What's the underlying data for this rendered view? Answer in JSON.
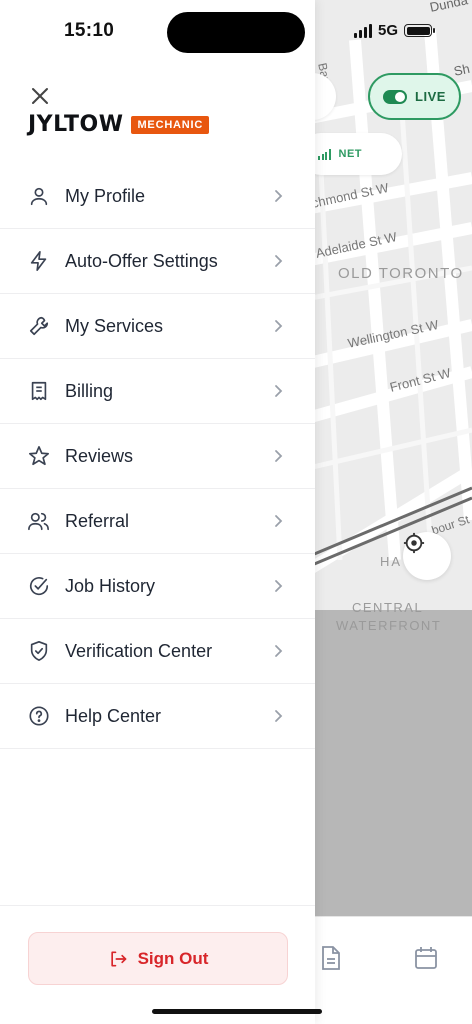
{
  "status_bar": {
    "time": "15:10",
    "network": "5G"
  },
  "brand": {
    "name": "JYLTOW",
    "badge": "MECHANIC",
    "badge_color": "#e8570f"
  },
  "menu": {
    "items": [
      {
        "label": "My Profile",
        "icon": "user-icon"
      },
      {
        "label": "Auto-Offer Settings",
        "icon": "lightning-icon"
      },
      {
        "label": "My Services",
        "icon": "wrench-icon"
      },
      {
        "label": "Billing",
        "icon": "receipt-icon"
      },
      {
        "label": "Reviews",
        "icon": "star-icon"
      },
      {
        "label": "Referral",
        "icon": "users-icon"
      },
      {
        "label": "Job History",
        "icon": "check-circle-icon"
      },
      {
        "label": "Verification Center",
        "icon": "shield-check-icon"
      },
      {
        "label": "Help Center",
        "icon": "help-circle-icon"
      }
    ]
  },
  "sign_out": {
    "label": "Sign Out",
    "color": "#d8262a"
  },
  "map": {
    "live_label": "LIVE",
    "net_label": "NET",
    "live_color": "#2e9a62",
    "labels": {
      "dundas": "Dunda",
      "bay": "Bay St",
      "sh": "Sh",
      "richmond": "chmond St W",
      "adelaide": "Adelaide St W",
      "old_toronto": "OLD TORONTO",
      "wellington": "Wellington St W",
      "front": "Front St W",
      "harbour": "bour St",
      "harbourfront": "HA   RFR",
      "central": "CENTRAL",
      "waterfront": "WATERFRONT"
    }
  }
}
